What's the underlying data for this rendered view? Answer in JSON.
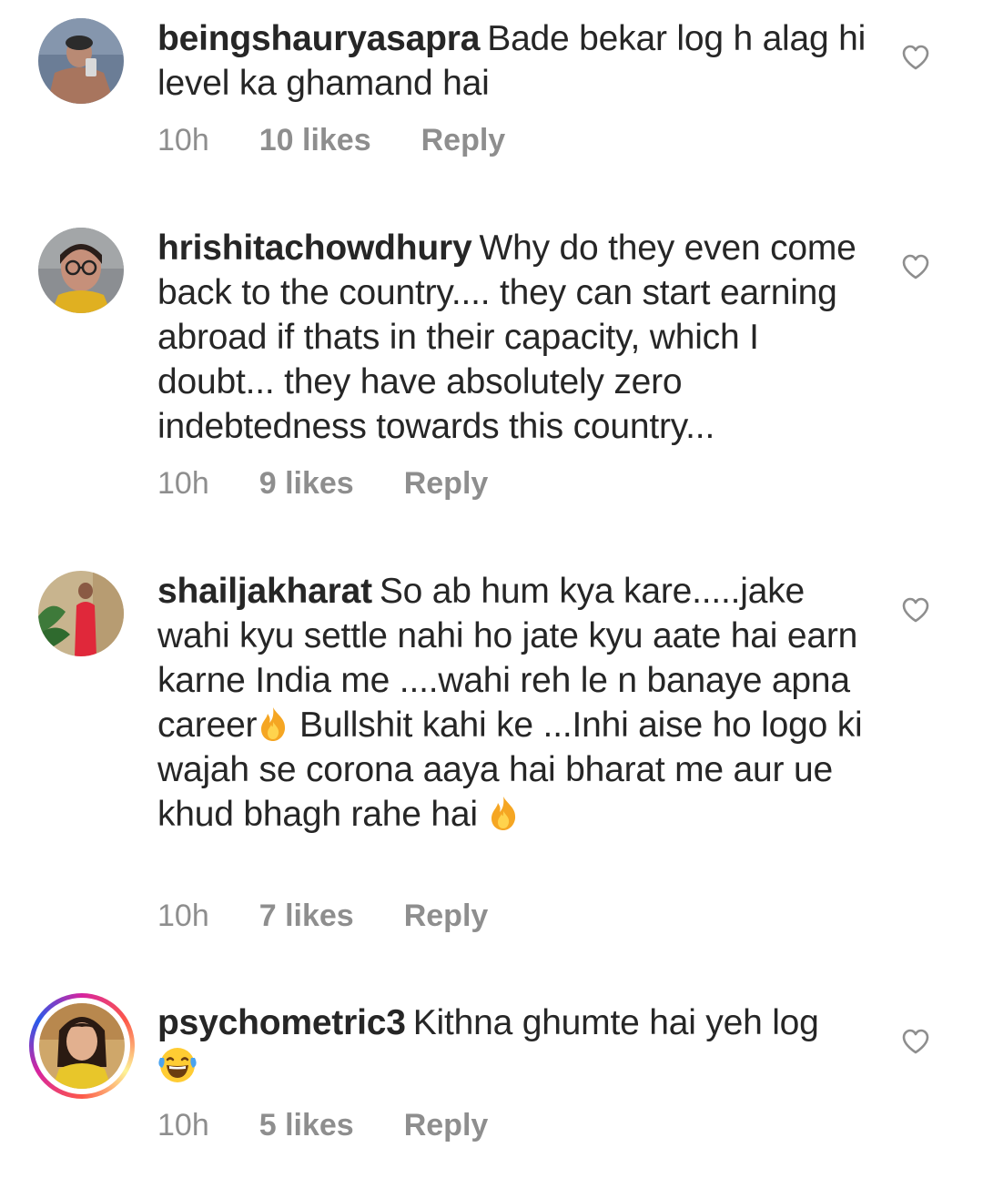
{
  "comments": [
    {
      "username": "beingshauryasapra",
      "text": "Bade bekar log h alag hi level ka ghamand hai",
      "time": "10h",
      "likes": "10 likes",
      "reply": "Reply",
      "avatar_icon": "avatar-photo"
    },
    {
      "username": "hrishitachowdhury",
      "text": "Why do they even come back to the country.... they can start earning abroad if thats in their capacity, which I doubt... they have absolutely zero indebtedness towards this country...",
      "time": "10h",
      "likes": "9 likes",
      "reply": "Reply",
      "avatar_icon": "avatar-photo"
    },
    {
      "username": "shailjakharat",
      "text_part1": "So ab hum kya kare.....jake wahi kyu settle nahi ho jate kyu aate hai earn karne India me ....wahi reh le n banaye apna career",
      "text_part2": "Bullshit kahi ke ...Inhi aise ho logo ki wajah se corona aaya hai bharat me aur ue khud bhagh rahe hai",
      "time": "10h",
      "likes": "7 likes",
      "reply": "Reply",
      "emoji_icon": "fire-emoji"
    },
    {
      "username": "psychometric3",
      "text": "Kithna ghumte hai yeh log",
      "time": "10h",
      "likes": "5 likes",
      "reply": "Reply",
      "emoji_icon": "laughing-tears-emoji",
      "has_story_ring": true
    }
  ],
  "colors": {
    "text": "#262626",
    "meta": "#8e8e8e",
    "heart_outline": "#8e8e8e"
  },
  "icons": {
    "like": "heart-outline-icon"
  }
}
